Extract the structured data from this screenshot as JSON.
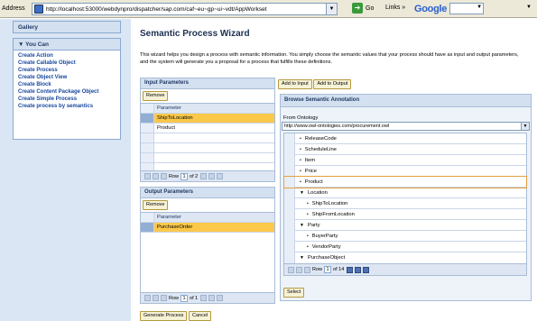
{
  "browser": {
    "address_label": "Address",
    "url": "http://localhost:53000/webdynpro/dispatcher/sap.com/caf~eu~gp~ui~vdt/AppWorkset",
    "go_label": "Go",
    "links_label": "Links",
    "links_chevron": "»",
    "google_label": "Google",
    "dropdown_glyph": "▼"
  },
  "sidebar": {
    "gallery_label": "Gallery",
    "you_can_label": "▼  You Can",
    "items": [
      {
        "label": "Create Action"
      },
      {
        "label": "Create Callable Object"
      },
      {
        "label": "Create Process"
      },
      {
        "label": "Create Object View"
      },
      {
        "label": "Create Block"
      },
      {
        "label": "Create Content Package Object"
      },
      {
        "label": "Create Simple Process"
      },
      {
        "label": "Create process by semantics"
      }
    ]
  },
  "main": {
    "title": "Semantic Process Wizard",
    "intro": "This wizard helps you design a process with semantic information. You simply choose the semantic values that your process should have as input and output parameters, and the system will generate you a proposal  for a process that fulfills these definitions."
  },
  "input_panel": {
    "title": "Input Parameters",
    "remove_label": "Remove",
    "column_header": "Parameter",
    "rows": [
      {
        "value": "ShipToLocation",
        "selected": true
      },
      {
        "value": "Product",
        "selected": false
      }
    ],
    "pager_row_label": "Row",
    "pager_row": "1",
    "pager_of": "of 2"
  },
  "output_panel": {
    "title": "Output Parameters",
    "remove_label": "Remove",
    "column_header": "Parameter",
    "rows": [
      {
        "value": "PurchaseOrder",
        "selected": true
      }
    ],
    "pager_row_label": "Row",
    "pager_row": "1",
    "pager_of": "of 1"
  },
  "actions": {
    "add_input_label": "Add to Input",
    "add_output_label": "Add to Output",
    "generate_label": "Generate Process",
    "cancel_label": "Cancel"
  },
  "browse": {
    "title": "Browse Semantic Annotation",
    "ontology_label": "From Ontology",
    "ontology_value": "http://www.owl-ontologies.com/procurement.owl",
    "tree": [
      {
        "label": "ReleaseCode",
        "marker": "•",
        "indent": 0
      },
      {
        "label": "ScheduleLine",
        "marker": "•",
        "indent": 0
      },
      {
        "label": "Item",
        "marker": "•",
        "indent": 0
      },
      {
        "label": "Price",
        "marker": "•",
        "indent": 0
      },
      {
        "label": "Product",
        "marker": "•",
        "indent": 0,
        "highlight": true
      },
      {
        "label": "Location",
        "marker": "▼",
        "indent": 0
      },
      {
        "label": "ShipToLocation",
        "marker": "•",
        "indent": 1
      },
      {
        "label": "ShipFromLocation",
        "marker": "•",
        "indent": 1
      },
      {
        "label": "Party",
        "marker": "▼",
        "indent": 0
      },
      {
        "label": "BuyerParty",
        "marker": "•",
        "indent": 1
      },
      {
        "label": "VendorParty",
        "marker": "•",
        "indent": 1
      },
      {
        "label": "PurchaseObject",
        "marker": "▼",
        "indent": 0
      }
    ],
    "pager_row_label": "Row",
    "pager_row": "1",
    "pager_of": "of 14",
    "select_label": "Select"
  },
  "colors": {
    "sidebar_bg": "#dbe6f4",
    "panel_header_bg": "#d3e0f0",
    "selected_row": "#fcc84a",
    "link_color": "#17479e"
  }
}
